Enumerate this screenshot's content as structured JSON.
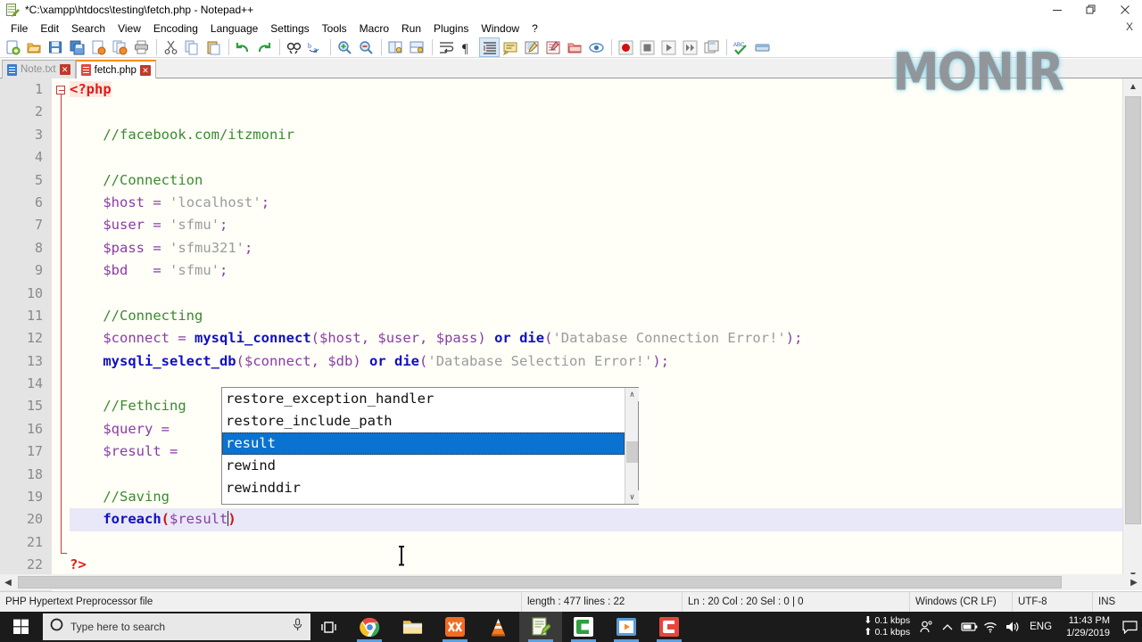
{
  "window": {
    "title": "*C:\\xampp\\htdocs\\testing\\fetch.php - Notepad++",
    "icon": "notepad-plus-plus-icon",
    "minimize_label": "—",
    "restore_label": "❐",
    "close_label": "✕",
    "document_close_label": "X"
  },
  "menu": {
    "items": [
      {
        "label": "File"
      },
      {
        "label": "Edit"
      },
      {
        "label": "Search"
      },
      {
        "label": "View"
      },
      {
        "label": "Encoding"
      },
      {
        "label": "Language"
      },
      {
        "label": "Settings"
      },
      {
        "label": "Tools"
      },
      {
        "label": "Macro"
      },
      {
        "label": "Run"
      },
      {
        "label": "Plugins"
      },
      {
        "label": "Window"
      },
      {
        "label": "?"
      }
    ]
  },
  "toolbar": {
    "buttons": [
      {
        "name": "new-file-icon",
        "tip": "New"
      },
      {
        "name": "open-file-icon",
        "tip": "Open"
      },
      {
        "name": "save-icon",
        "tip": "Save"
      },
      {
        "name": "save-all-icon",
        "tip": "Save All"
      },
      {
        "name": "close-file-icon",
        "tip": "Close"
      },
      {
        "name": "close-all-icon",
        "tip": "Close All"
      },
      {
        "name": "print-icon",
        "tip": "Print"
      },
      {
        "name": "separator",
        "tip": ""
      },
      {
        "name": "cut-icon",
        "tip": "Cut"
      },
      {
        "name": "copy-icon",
        "tip": "Copy"
      },
      {
        "name": "paste-icon",
        "tip": "Paste"
      },
      {
        "name": "separator",
        "tip": ""
      },
      {
        "name": "undo-icon",
        "tip": "Undo"
      },
      {
        "name": "redo-icon",
        "tip": "Redo"
      },
      {
        "name": "separator",
        "tip": ""
      },
      {
        "name": "find-icon",
        "tip": "Find"
      },
      {
        "name": "replace-icon",
        "tip": "Replace"
      },
      {
        "name": "separator",
        "tip": ""
      },
      {
        "name": "zoom-in-icon",
        "tip": "Zoom In"
      },
      {
        "name": "zoom-out-icon",
        "tip": "Zoom Out"
      },
      {
        "name": "separator",
        "tip": ""
      },
      {
        "name": "sync-vertical-icon",
        "tip": "Synchronize Vertical Scrolling"
      },
      {
        "name": "sync-horizontal-icon",
        "tip": "Synchronize Horizontal Scrolling"
      },
      {
        "name": "separator",
        "tip": ""
      },
      {
        "name": "word-wrap-icon",
        "tip": "Word Wrap"
      },
      {
        "name": "show-all-chars-icon",
        "tip": "Show All Characters"
      },
      {
        "name": "indent-guide-icon",
        "tip": "Show Indent Guide"
      },
      {
        "name": "user-language-icon",
        "tip": "User Defined Dialogue"
      },
      {
        "name": "doc-map-icon",
        "tip": "Document Map"
      },
      {
        "name": "function-list-icon",
        "tip": "Function List"
      },
      {
        "name": "folder-workspace-icon",
        "tip": "Folder as Workspace"
      },
      {
        "name": "monitoring-icon",
        "tip": "Monitoring"
      },
      {
        "name": "separator",
        "tip": ""
      },
      {
        "name": "record-macro-icon",
        "tip": "Start Recording"
      },
      {
        "name": "stop-macro-icon",
        "tip": "Stop Recording"
      },
      {
        "name": "play-macro-icon",
        "tip": "Playback"
      },
      {
        "name": "run-macro-multi-icon",
        "tip": "Run a Macro Multiple Times"
      },
      {
        "name": "save-macro-icon",
        "tip": "Save Current Recorded Macro"
      },
      {
        "name": "separator",
        "tip": ""
      },
      {
        "name": "spell-check-icon",
        "tip": "Spell Checker"
      },
      {
        "name": "run-icon",
        "tip": "Run"
      }
    ]
  },
  "tabs": [
    {
      "label": "Note.txt",
      "active": false,
      "icon": "blue-document-icon",
      "close_label": "✕"
    },
    {
      "label": "fetch.php",
      "active": true,
      "icon": "red-document-icon",
      "close_label": "✕"
    }
  ],
  "editor": {
    "lines": [
      {
        "n": "1",
        "text": "<?php"
      },
      {
        "n": "2",
        "text": ""
      },
      {
        "n": "3",
        "text": "    //facebook.com/itzmonir"
      },
      {
        "n": "4",
        "text": ""
      },
      {
        "n": "5",
        "text": "    //Connection"
      },
      {
        "n": "6",
        "text": "    $host = 'localhost';"
      },
      {
        "n": "7",
        "text": "    $user = 'sfmu';"
      },
      {
        "n": "8",
        "text": "    $pass = 'sfmu321';"
      },
      {
        "n": "9",
        "text": "    $bd   = 'sfmu';"
      },
      {
        "n": "10",
        "text": ""
      },
      {
        "n": "11",
        "text": "    //Connecting"
      },
      {
        "n": "12",
        "text": "    $connect = mysqli_connect($host, $user, $pass) or die('Database Connection Error!');"
      },
      {
        "n": "13",
        "text": "    mysqli_select_db($connect, $db) or die('Database Selection Error!');"
      },
      {
        "n": "14",
        "text": ""
      },
      {
        "n": "15",
        "text": "    //Fethcing"
      },
      {
        "n": "16",
        "text": "    $query = "
      },
      {
        "n": "17",
        "text": "    $result = "
      },
      {
        "n": "18",
        "text": ""
      },
      {
        "n": "19",
        "text": "    //Saving"
      },
      {
        "n": "20",
        "text": "    foreach($result)"
      },
      {
        "n": "21",
        "text": ""
      },
      {
        "n": "22",
        "text": "?>"
      }
    ]
  },
  "autocomplete": {
    "items": [
      {
        "label": "restore_exception_handler",
        "selected": false
      },
      {
        "label": "restore_include_path",
        "selected": false
      },
      {
        "label": "result",
        "selected": true
      },
      {
        "label": "rewind",
        "selected": false
      },
      {
        "label": "rewinddir",
        "selected": false
      }
    ],
    "scroll_up_label": "∧",
    "scroll_down_label": "∨",
    "highlight_color": "#0a72d0"
  },
  "status_bar": {
    "language": "PHP Hypertext Preprocessor file",
    "length_lines": "length : 477    lines : 22",
    "position": "Ln : 20    Col : 20    Sel : 0 | 0",
    "eol": "Windows (CR LF)",
    "encoding": "UTF-8",
    "insert_mode": "INS"
  },
  "watermark": {
    "text": "MONIR"
  },
  "taskbar": {
    "start_label": "start-button",
    "search_placeholder": "Type here to search",
    "search_icon": "circle-search-icon",
    "mic_icon": "microphone-icon",
    "task_view_icon": "task-view-icon",
    "apps": [
      {
        "name": "chrome-taskbar-icon",
        "label": "Google Chrome",
        "active": false,
        "running": true
      },
      {
        "name": "file-explorer-taskbar-icon",
        "label": "File Explorer",
        "active": false,
        "running": false
      },
      {
        "name": "xampp-taskbar-icon",
        "label": "XAMPP",
        "active": false,
        "running": true
      },
      {
        "name": "vlc-taskbar-icon",
        "label": "VLC Media Player",
        "active": false,
        "running": false
      },
      {
        "name": "notepadpp-taskbar-icon",
        "label": "Notepad++",
        "active": true,
        "running": true
      },
      {
        "name": "camtasia-taskbar-icon",
        "label": "Camtasia Studio",
        "active": false,
        "running": true
      },
      {
        "name": "movie-maker-taskbar-icon",
        "label": "Movie Maker",
        "active": false,
        "running": true
      },
      {
        "name": "camtasia-recorder-icon",
        "label": "Camtasia Recorder",
        "active": false,
        "running": true
      }
    ],
    "tray": {
      "download_speed": "0.1 kbps",
      "upload_speed": "0.1 kbps",
      "people_icon": "people-icon",
      "show_hidden_icon": "chevron-up-icon",
      "battery_icon": "battery-icon",
      "wifi_icon": "wifi-icon",
      "volume_icon": "speaker-icon",
      "language": "ENG",
      "time": "11:43 PM",
      "date": "1/29/2019",
      "notification_icon": "notification-icon"
    }
  }
}
